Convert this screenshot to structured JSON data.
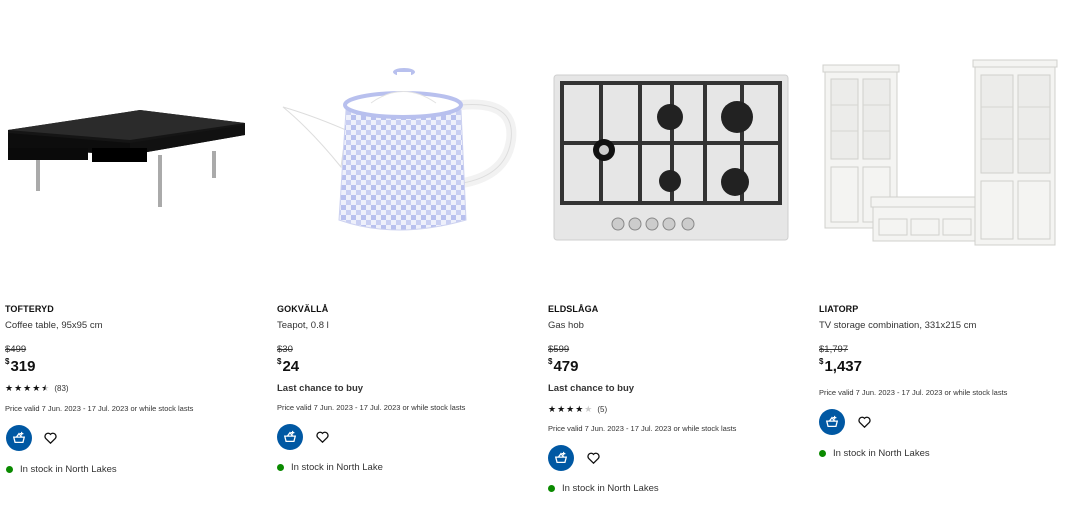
{
  "products": [
    {
      "name": "TOFTERYD",
      "description": "Coffee table, 95x95 cm",
      "old_price": "$499",
      "currency": "$",
      "price": "319",
      "rating_count": "(83)",
      "rating": 4.5,
      "last_chance": "",
      "validity": "Price valid 7 Jun. 2023 - 17 Jul. 2023 or while stock lasts",
      "stock": "In stock in North Lakes"
    },
    {
      "name": "GOKVÄLLÅ",
      "description": "Teapot, 0.8 l",
      "old_price": "$30",
      "currency": "$",
      "price": "24",
      "rating_count": "",
      "last_chance": "Last chance to buy",
      "validity": "Price valid 7 Jun. 2023 - 17 Jul. 2023 or while stock lasts",
      "stock": "In stock in North Lake"
    },
    {
      "name": "ELDSLÅGA",
      "description": "Gas hob",
      "old_price": "$599",
      "currency": "$",
      "price": "479",
      "rating_count": "(5)",
      "rating": 4,
      "last_chance": "Last chance to buy",
      "validity": "Price valid 7 Jun. 2023 - 17 Jul. 2023 or while stock lasts",
      "stock": "In stock in North Lakes"
    },
    {
      "name": "LIATORP",
      "description": "TV storage combination, 331x215 cm",
      "old_price": "$1,797",
      "currency": "$",
      "price": "1,437",
      "rating_count": "",
      "last_chance": "",
      "validity": "Price valid 7 Jun. 2023 - 17 Jul. 2023 or while stock lasts",
      "stock": "In stock in North Lakes"
    }
  ],
  "colors": {
    "accent": "#0058a3",
    "in_stock": "#0a8a00"
  },
  "icons": {
    "cart": "add-to-cart-icon",
    "favourite": "heart-icon"
  }
}
